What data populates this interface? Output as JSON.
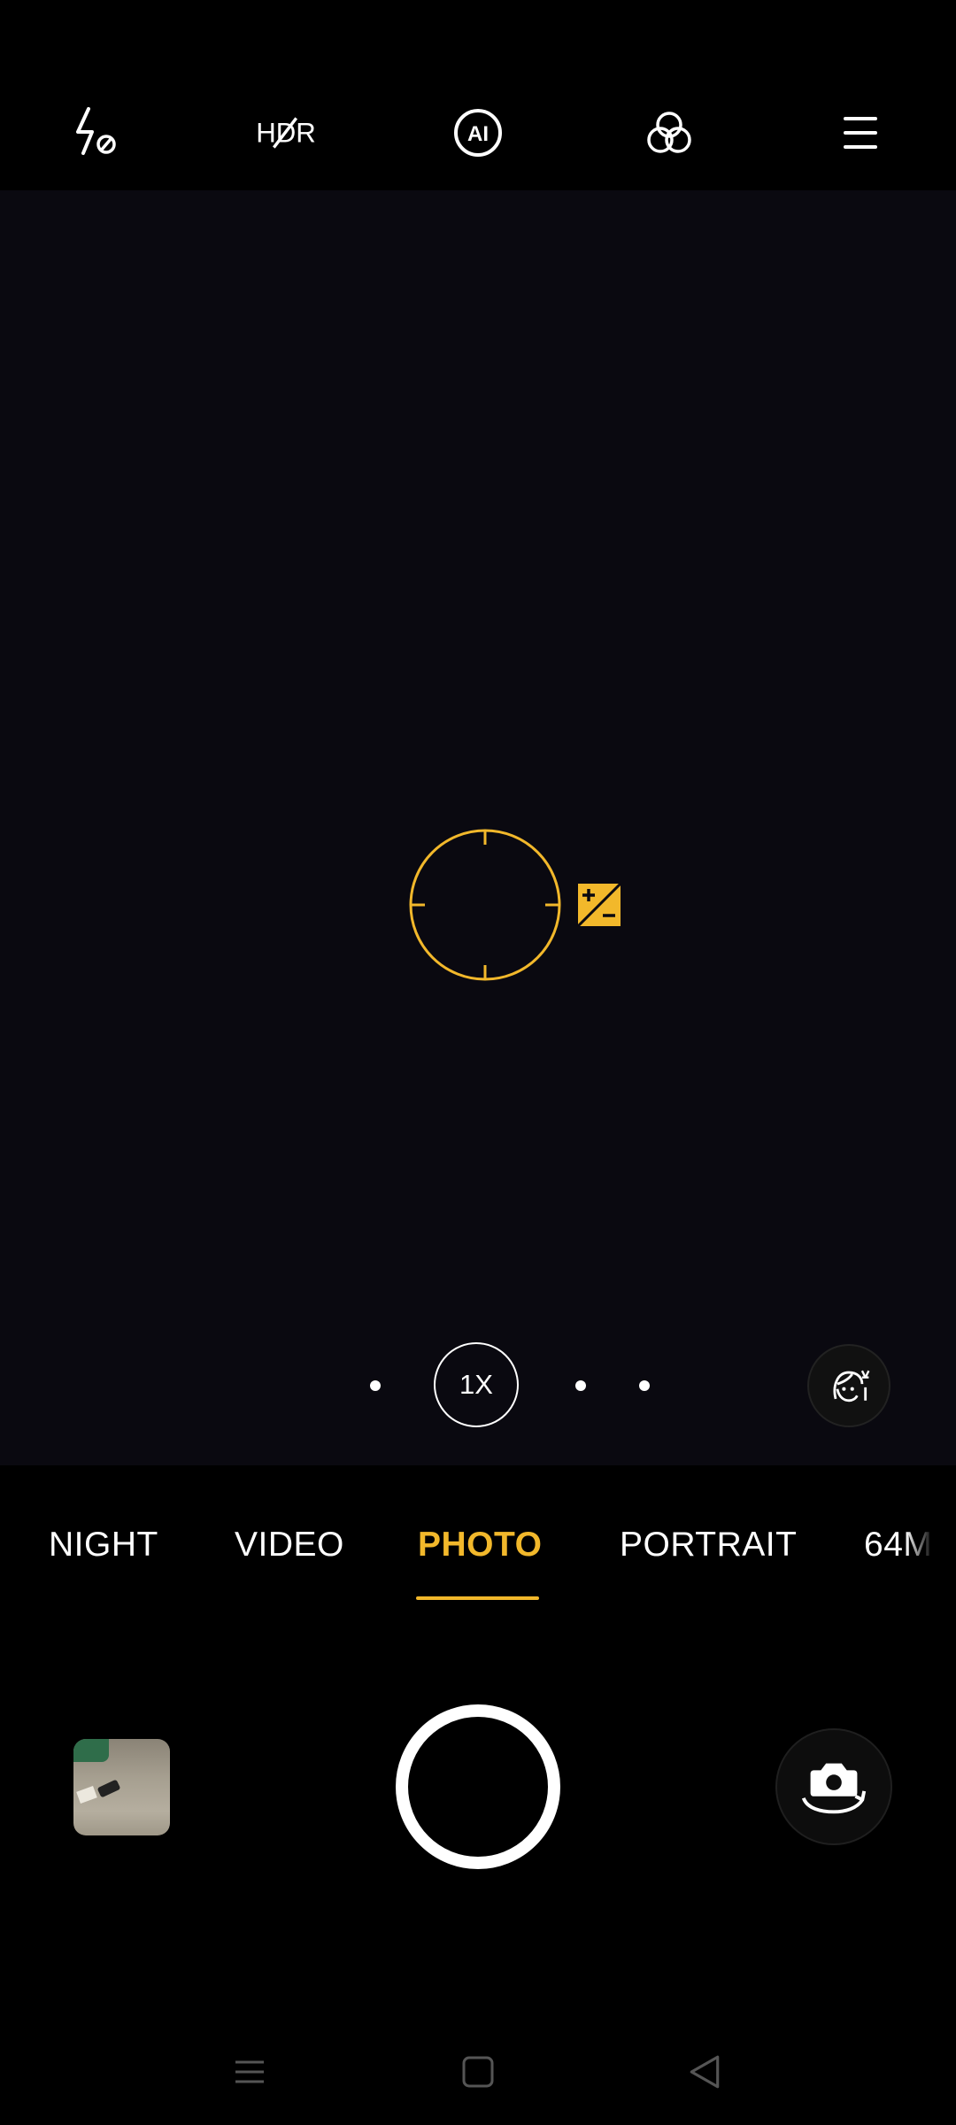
{
  "top_bar": {
    "icons": [
      "flash-off-icon",
      "hdr-off-icon",
      "ai-scene-icon",
      "filter-icon",
      "menu-icon"
    ]
  },
  "viewfinder": {
    "zoom_label": "1X",
    "focus_color": "#f2b82b"
  },
  "modes": {
    "items": [
      "NIGHT",
      "VIDEO",
      "PHOTO",
      "PORTRAIT",
      "64M"
    ],
    "active": "PHOTO",
    "accent": "#f2b82b"
  },
  "controls": {
    "icons": [
      "gallery-thumbnail",
      "shutter-button",
      "switch-camera-icon",
      "beauty-icon"
    ]
  },
  "nav": {
    "icons": [
      "recents-icon",
      "home-icon",
      "back-icon"
    ]
  }
}
